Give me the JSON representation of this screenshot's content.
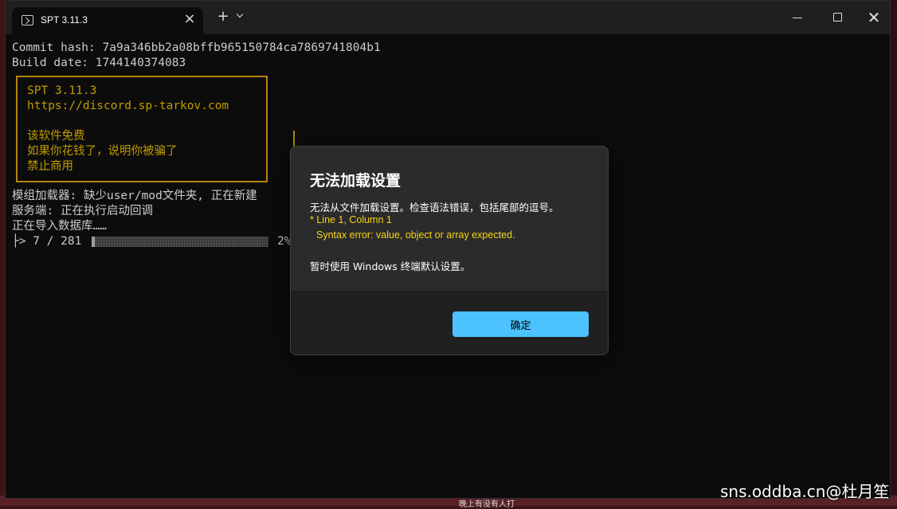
{
  "tab": {
    "title": "SPT 3.11.3"
  },
  "terminal": {
    "commit_line": "Commit hash: 7a9a346bb2a08bffb965150784ca7869741804b1",
    "build_line": "Build date: 1744140374083",
    "banner": [
      "SPT 3.11.3",
      "https://discord.sp-tarkov.com",
      "",
      "该软件免费",
      "如果你花钱了，说明你被骗了",
      "禁止商用"
    ],
    "log_lines": [
      "模组加载器: 缺少user/mod文件夹, 正在新建",
      "服务端: 正在执行启动回调",
      "正在导入数据库……"
    ],
    "progress_label": "├> 7 / 281",
    "progress_value": 2,
    "progress_pct": "2%"
  },
  "dialog": {
    "title": "无法加载设置",
    "message": "无法从文件加载设置。检查语法错误，包括尾部的逗号。",
    "error_line1": "* Line 1, Column 1",
    "error_line2": "Syntax error: value, object or array expected.",
    "note": "暂时使用 Windows 终端默认设置。",
    "ok_label": "确定"
  },
  "watermark": "sns.oddba.cn@杜月笙",
  "bottom_snippet": "晚上有没有人打",
  "colors": {
    "accent": "#4cc2ff",
    "banner": "#c19c00",
    "error": "#f5d515"
  }
}
